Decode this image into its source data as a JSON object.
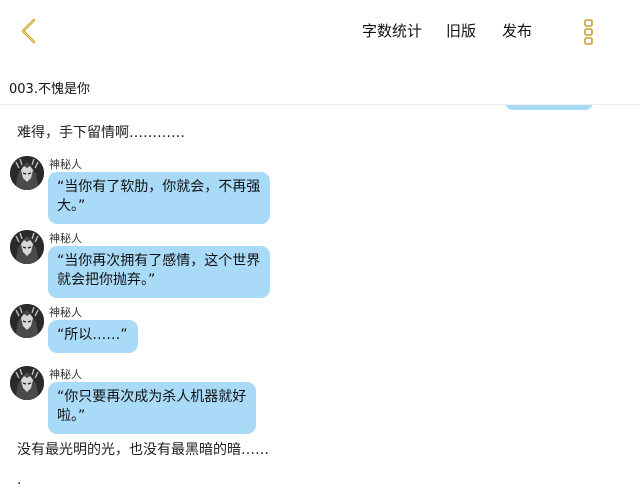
{
  "topbar": {
    "word_count_label": "字数统计",
    "old_version_label": "旧版",
    "publish_label": "发布",
    "accent_color": "#c9a227"
  },
  "chapter": {
    "title": "003.不愧是你"
  },
  "content": {
    "narration_1": "难得，手下留情啊…………",
    "messages": [
      {
        "sender": "神秘人",
        "lines": [
          "“当你有了软肋，你就会，不再强",
          "大。”"
        ]
      },
      {
        "sender": "神秘人",
        "lines": [
          "“当你再次拥有了感情，这个世界",
          "就会把你抛弃。”"
        ]
      },
      {
        "sender": "神秘人",
        "lines": [
          "“所以……”"
        ]
      },
      {
        "sender": "神秘人",
        "lines": [
          "“你只要再次成为杀人机器就好",
          "啦。”"
        ]
      }
    ],
    "narration_2": "没有最光明的光，也没有最黑暗的暗……",
    "narration_3": "."
  },
  "colors": {
    "bubble": "#a9daf8",
    "divider": "#eeeeee"
  }
}
